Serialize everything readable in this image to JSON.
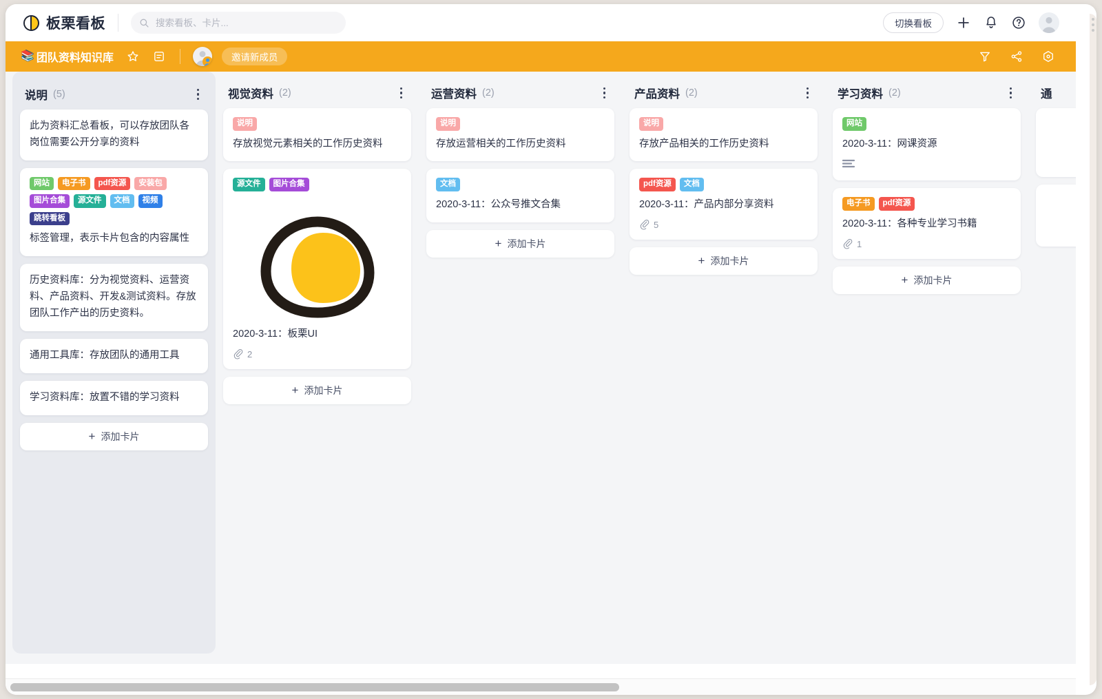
{
  "app": {
    "logo_text": "板栗看板",
    "logo_icon": "chestnut-moon-icon"
  },
  "search": {
    "placeholder": "搜索看板、卡片...",
    "value": "",
    "icon": "search-icon"
  },
  "topbar": {
    "switch_board_label": "切换看板",
    "add_icon": "plus-icon",
    "notification_icon": "bell-icon",
    "help_icon": "question-circle-icon",
    "avatar_icon": "user-avatar-icon"
  },
  "boardbar": {
    "emoji": "📚",
    "title": "团队资料知识库",
    "star_icon": "star-icon",
    "description_icon": "description-icon",
    "member_avatar_icon": "member-avatar-icon",
    "invite_label": "邀请新成员",
    "filter_icon": "filter-icon",
    "share_icon": "share-icon",
    "settings_icon": "hexagon-settings-icon",
    "accent_color": "#f5a81c"
  },
  "tag_colors": {
    "网站": "#6fc96a",
    "电子书": "#f59a22",
    "pdf资源": "#f4564e",
    "安装包": "#f9a8a8",
    "图片合集": "#a54cd8",
    "源文件": "#25b097",
    "文档": "#62bdf0",
    "视频": "#2f80e8",
    "跳转看板": "#3b3f8c",
    "说明": "#f9a8a8"
  },
  "add_card_label": "添加卡片",
  "columns": [
    {
      "title": "说明",
      "count": "(5)",
      "highlighted": true,
      "cards": [
        {
          "tags": [],
          "text": "此为资料汇总看板，可以存放团队各岗位需要公开分享的资料"
        },
        {
          "tags": [
            "网站",
            "电子书",
            "pdf资源",
            "安装包",
            "图片合集",
            "源文件",
            "文档",
            "视频",
            "跳转看板"
          ],
          "text": "标签管理，表示卡片包含的内容属性"
        },
        {
          "tags": [],
          "text": "历史资料库：分为视觉资料、运营资料、产品资料、开发&测试资料。存放团队工作产出的历史资料。"
        },
        {
          "tags": [],
          "text": "通用工具库：存放团队的通用工具"
        },
        {
          "tags": [],
          "text": "学习资料库：放置不错的学习资料"
        }
      ]
    },
    {
      "title": "视觉资料",
      "count": "(2)",
      "highlighted": false,
      "cards": [
        {
          "tags": [
            "说明"
          ],
          "text": "存放视觉元素相关的工作历史资料"
        },
        {
          "tags": [
            "源文件",
            "图片合集"
          ],
          "text": "2020-3-11：板栗UI",
          "image": "chestnut-logo-image",
          "attachments": "2"
        }
      ]
    },
    {
      "title": "运营资料",
      "count": "(2)",
      "highlighted": false,
      "cards": [
        {
          "tags": [
            "说明"
          ],
          "text": "存放运营相关的工作历史资料"
        },
        {
          "tags": [
            "文档"
          ],
          "text": "2020-3-11：公众号推文合集"
        }
      ]
    },
    {
      "title": "产品资料",
      "count": "(2)",
      "highlighted": false,
      "cards": [
        {
          "tags": [
            "说明"
          ],
          "text": "存放产品相关的工作历史资料"
        },
        {
          "tags": [
            "pdf资源",
            "文档"
          ],
          "text": "2020-3-11：产品内部分享资料",
          "attachments": "5"
        }
      ]
    },
    {
      "title": "学习资料",
      "count": "(2)",
      "highlighted": false,
      "cards": [
        {
          "tags": [
            "网站"
          ],
          "text": "2020-3-11：网课资源",
          "description": true
        },
        {
          "tags": [
            "电子书",
            "pdf资源"
          ],
          "text": "2020-3-11：各种专业学习书籍",
          "attachments": "1"
        }
      ]
    },
    {
      "title": "通",
      "count": "",
      "highlighted": false,
      "partial": true,
      "cards": [
        {
          "tags": [],
          "text": ""
        },
        {
          "tags": [],
          "text": ""
        }
      ]
    }
  ]
}
